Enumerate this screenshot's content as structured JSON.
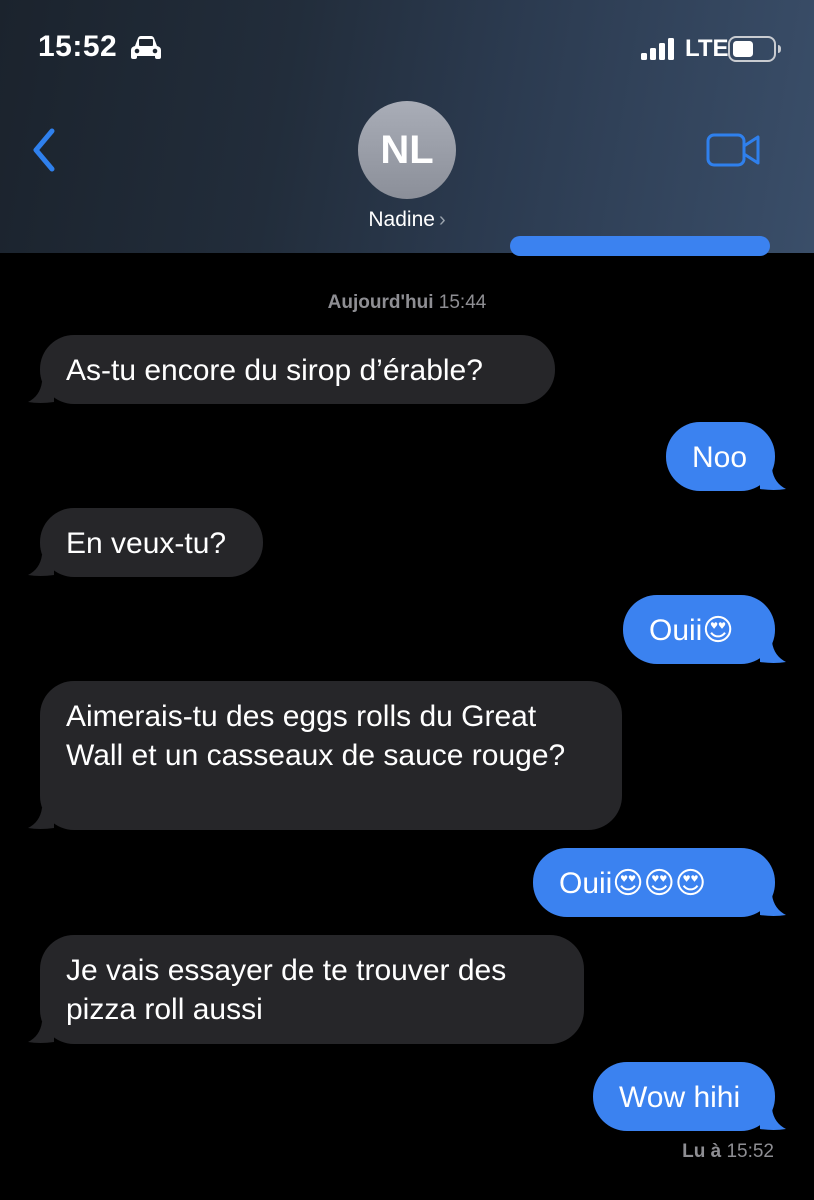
{
  "status_bar": {
    "time": "15:52",
    "network": "LTE"
  },
  "header": {
    "avatar_initials": "NL",
    "contact_name": "Nadine",
    "name_chevron": "›"
  },
  "conversation": {
    "timestamp_day": "Aujourd'hui",
    "timestamp_time": "15:44",
    "messages": [
      {
        "from": "them",
        "text": "As-tu encore du sirop d’érable?"
      },
      {
        "from": "me",
        "text": "Noo"
      },
      {
        "from": "them",
        "text": "En veux-tu?"
      },
      {
        "from": "me",
        "text": "Ouii😍"
      },
      {
        "from": "them",
        "text": "Aimerais-tu des eggs rolls du Great Wall et un casseaux de sauce rouge?"
      },
      {
        "from": "me",
        "text": "Ouii😍😍😍"
      },
      {
        "from": "them",
        "text": "Je vais essayer de te trouver des pizza roll aussi"
      },
      {
        "from": "me",
        "text": "Wow hihi"
      }
    ],
    "read_label": "Lu à",
    "read_time": "15:52"
  },
  "colors": {
    "accent_blue": "#3b82f0",
    "incoming_bubble": "#262629",
    "icon_blue": "#2f80ed"
  }
}
